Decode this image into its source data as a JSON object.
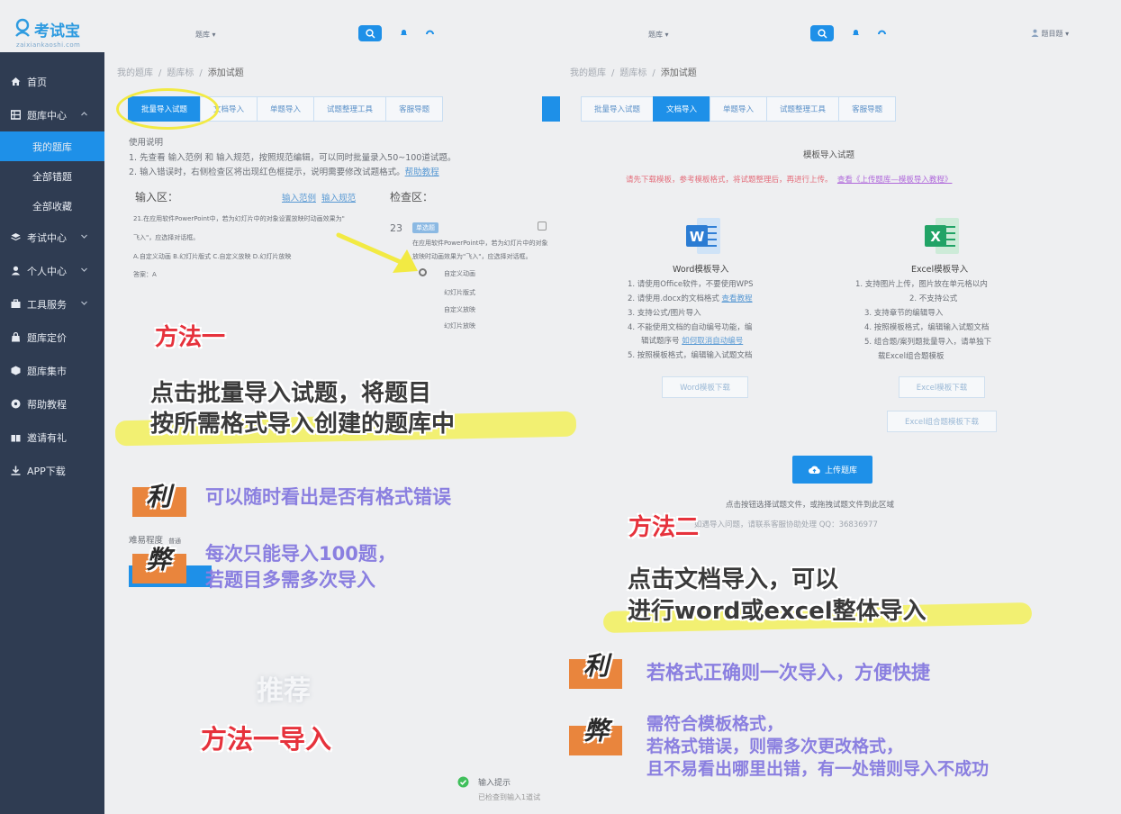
{
  "brand": {
    "name": "考试宝",
    "sub": "zaixiankaoshi.com"
  },
  "sidebar": {
    "items": [
      {
        "label": "首页",
        "icon": "home-icon"
      },
      {
        "label": "题库中心",
        "icon": "grid-icon"
      },
      {
        "label": "考试中心",
        "icon": "layers-icon"
      },
      {
        "label": "个人中心",
        "icon": "user-icon"
      },
      {
        "label": "工具服务",
        "icon": "toolbox-icon"
      },
      {
        "label": "题库定价",
        "icon": "bag-icon"
      },
      {
        "label": "题库集市",
        "icon": "cube-icon"
      },
      {
        "label": "帮助教程",
        "icon": "help-icon"
      },
      {
        "label": "邀请有礼",
        "icon": "gift-icon"
      },
      {
        "label": "APP下载",
        "icon": "download-icon"
      }
    ],
    "sub": [
      "我的题库",
      "全部错题",
      "全部收藏"
    ]
  },
  "header": {
    "left_select": "题库",
    "right_select": "题库",
    "user": "题目题"
  },
  "left": {
    "breadcrumb": [
      "我的题库",
      "题库标",
      "添加试题"
    ],
    "tabs": [
      "批量导入试题",
      "文档导入",
      "单题导入",
      "试题整理工具",
      "客服导题"
    ],
    "usage_title": "使用说明",
    "usage_1": "1. 先查看 输入范例 和 输入规范，按照规范编辑，可以同时批量录入50~100道试题。",
    "usage_2": "2. 输入错误时，右侧检查区将出现红色框提示，说明需要修改试题格式。",
    "usage_2_link": "帮助教程",
    "input_label": "输入区：",
    "input_link_1": "输入范例",
    "input_link_2": "输入规范",
    "check_label": "检查区：",
    "q_text": "21.在应用软件PowerPoint中，若为幻灯片中的对象设置放映时动画效果为\"",
    "q_text2": "飞入\"，应选择对话框。",
    "q_opts": "A.自定义动画    B.幻灯片版式    C.自定义放映    D.幻灯片放映",
    "q_ans": "答案：A",
    "check_num": "23",
    "check_tag": "单选题",
    "check_text": "在应用软件PowerPoint中，若为幻灯片中的对象",
    "check_text2": "放映时动画效果为\"飞入\"，应选择对话框。",
    "check_opts": [
      "自定义动画",
      "幻灯片版式",
      "自定义放映",
      "幻灯片放映"
    ],
    "difficulty": "难易程度",
    "difficulty_val": "普通",
    "tip_title": "输入提示",
    "tip_sub": "已检查到输入1道试"
  },
  "right": {
    "breadcrumb": [
      "我的题库",
      "题库标",
      "添加试题"
    ],
    "tabs": [
      "批量导入试题",
      "文档导入",
      "单题导入",
      "试题整理工具",
      "客服导题"
    ],
    "title": "模板导入试题",
    "red_note": "请先下载模板，参考模板格式，将试题整理后，再进行上传。",
    "red_note_link": "查看《上传题库—模板导入教程》",
    "word_title": "Word模板导入",
    "word_items": [
      "1. 请使用Office软件，不要使用WPS",
      "2. 请使用.docx的文档格式",
      "3. 支持公式/图片导入",
      "4. 不能使用文档的自动编号功能，编",
      "辑试题序号",
      "5. 按照模板格式，编辑输入试题文档"
    ],
    "word_link_1": "查看教程",
    "word_link_2": "如何取消自动编号",
    "excel_title": "Excel模板导入",
    "excel_items": [
      "1. 支持图片上传，图片放在单元格以内",
      "2. 不支持公式",
      "3. 支持章节的编辑导入",
      "4. 按照模板格式，编辑输入试题文档",
      "5. 组合题/案列题批量导入，请单独下",
      "载Excel组合题模板"
    ],
    "word_btn": "Word模板下载",
    "excel_btn": "Excel模板下载",
    "excel_btn2": "Excel组合题模板下载",
    "upload_btn": "上传题库",
    "upload_hint": "点击按钮选择试题文件，或拖拽试题文件到此区域",
    "upload_hint2": "如遇导入问题，请联系客服协助处理 QQ：36836977"
  },
  "notes": {
    "m1": "方法一",
    "m1_desc_1": "点击批量导入试题，将题目",
    "m1_desc_2": "按所需格式导入创建的题库中",
    "pro": "利",
    "con": "弊",
    "m1_pro": "可以随时看出是否有格式错误",
    "m1_con_1": "每次只能导入100题，",
    "m1_con_2": "若题目多需多次导入",
    "recommend": "推荐",
    "recommend_method": "方法一导入",
    "m2": "方法二",
    "m2_desc_1": "点击文档导入，可以",
    "m2_desc_2": "进行word或excel整体导入",
    "m2_pro": "若格式正确则一次导入，方便快捷",
    "m2_con_1": "需符合模板格式，",
    "m2_con_2": "若格式错误，则需多次更改格式，",
    "m2_con_3": "且不易看出哪里出错，有一处错则导入不成功"
  },
  "colors": {
    "primary": "#1e90e8",
    "sidebar": "#2f3c52",
    "highlight": "#f3ef4e",
    "method": "#e6323c",
    "pro_con": "#8a7fe0",
    "badge_bg": "#e9853d"
  }
}
